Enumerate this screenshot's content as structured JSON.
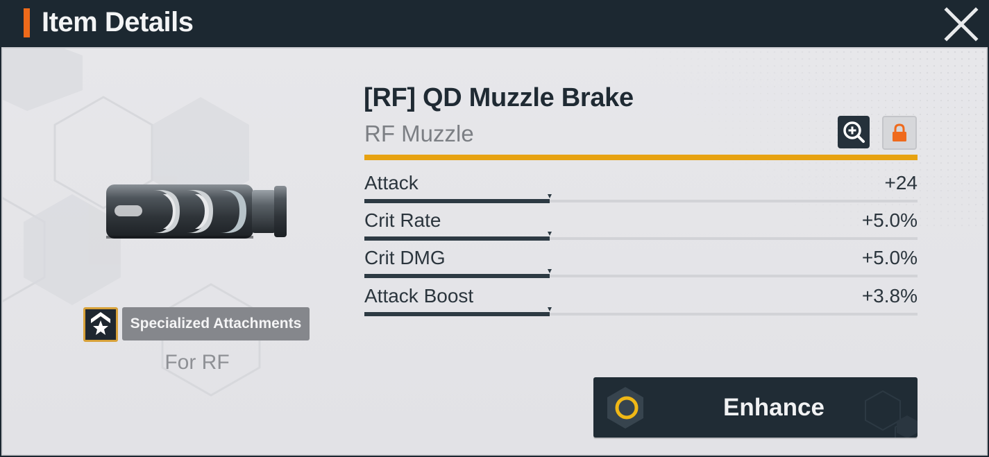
{
  "header": {
    "title": "Item Details"
  },
  "item": {
    "name": "[RF] QD Muzzle Brake",
    "type": "RF Muzzle",
    "rarity_color": "#e7a211",
    "specialization": "Specialized Attachments",
    "for_label": "For RF"
  },
  "stats": [
    {
      "name": "Attack",
      "value": "+24",
      "fill": 0.335
    },
    {
      "name": "Crit Rate",
      "value": "+5.0%",
      "fill": 0.335
    },
    {
      "name": "Crit DMG",
      "value": "+5.0%",
      "fill": 0.335
    },
    {
      "name": "Attack Boost",
      "value": "+3.8%",
      "fill": 0.335
    }
  ],
  "actions": {
    "enhance_label": "Enhance"
  },
  "icons": {
    "close": "close-icon",
    "zoom": "zoom-in-icon",
    "lock": "lock-icon",
    "enhance": "enhance-ring-icon",
    "specialization": "star-chevron-icon"
  },
  "colors": {
    "accent": "#ee6a1a",
    "header_bg": "#1c2831",
    "panel_bg": "#e5e5e8",
    "lock": "#ef6a1c",
    "enhance_ring": "#f0b816"
  }
}
